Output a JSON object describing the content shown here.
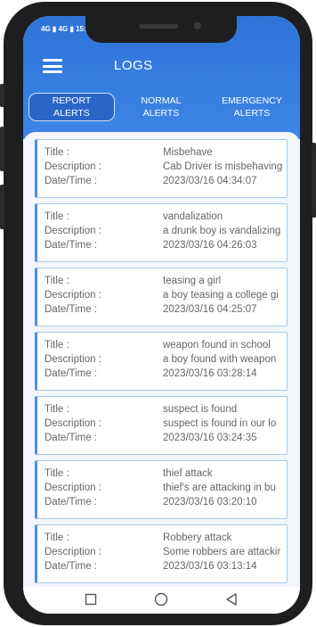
{
  "status_bar": {
    "network_1": "4G",
    "network_2": "4G",
    "time": "15:"
  },
  "header": {
    "title": "LOGS",
    "menu_icon": "hamburger-menu-icon",
    "color": "#2f73d9"
  },
  "tabs": [
    {
      "line1": "REPORT",
      "line2": "ALERTS",
      "active": true
    },
    {
      "line1": "NORMAL",
      "line2": "ALERTS",
      "active": false
    },
    {
      "line1": "EMERGENCY",
      "line2": "ALERTS",
      "active": false
    }
  ],
  "field_labels": {
    "title": "Title :",
    "description": "Description :",
    "datetime": "Date/Time :"
  },
  "logs": [
    {
      "title": "Misbehave",
      "description": "Cab Driver is misbehaving",
      "datetime": "2023/03/16 04:34:07"
    },
    {
      "title": "vandalization",
      "description": "a drunk boy is vandalizing",
      "datetime": "2023/03/16 04:26:03"
    },
    {
      "title": "teasing a girl",
      "description": "a boy teasing a college gi",
      "datetime": "2023/03/16 04:25:07"
    },
    {
      "title": "weapon found in school",
      "description": "a boy found with weapon",
      "datetime": "2023/03/16 03:28:14"
    },
    {
      "title": "suspect is found",
      "description": "suspect is found in our lo",
      "datetime": "2023/03/16 03:24:35"
    },
    {
      "title": "thief attack",
      "description": "thief's are attacking in bu",
      "datetime": "2023/03/16 03:20:10"
    },
    {
      "title": "Robbery attack",
      "description": "Some robbers are attackir",
      "datetime": "2023/03/16 03:13:14"
    }
  ],
  "navbar": {
    "icons": [
      "recents-square-icon",
      "home-circle-icon",
      "back-triangle-icon"
    ]
  },
  "colors": {
    "accent": "#2f73d9",
    "card_border": "#a8c9ef",
    "card_left": "#4b8fe0"
  }
}
